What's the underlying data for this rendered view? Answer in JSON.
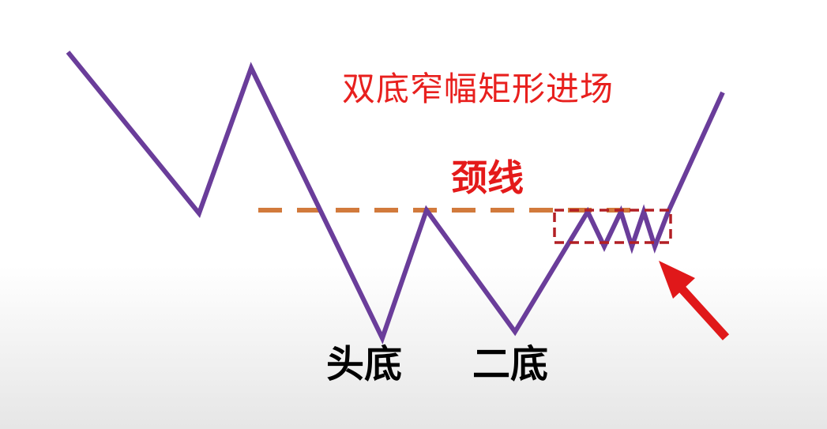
{
  "title": "双底窄幅矩形进场",
  "neckline_label": "颈线",
  "bottom_labels": [
    "头底",
    "二底"
  ],
  "colors": {
    "price_line": "#6a3d9a",
    "neckline": "#d27a3c",
    "title_text": "#e8201e",
    "neckline_text": "#e41a1a",
    "range_box": "#b21f24",
    "arrow": "#e0181a",
    "label_text": "#000000"
  },
  "icons": {
    "entry_arrow": "up-left-arrow-icon"
  }
}
